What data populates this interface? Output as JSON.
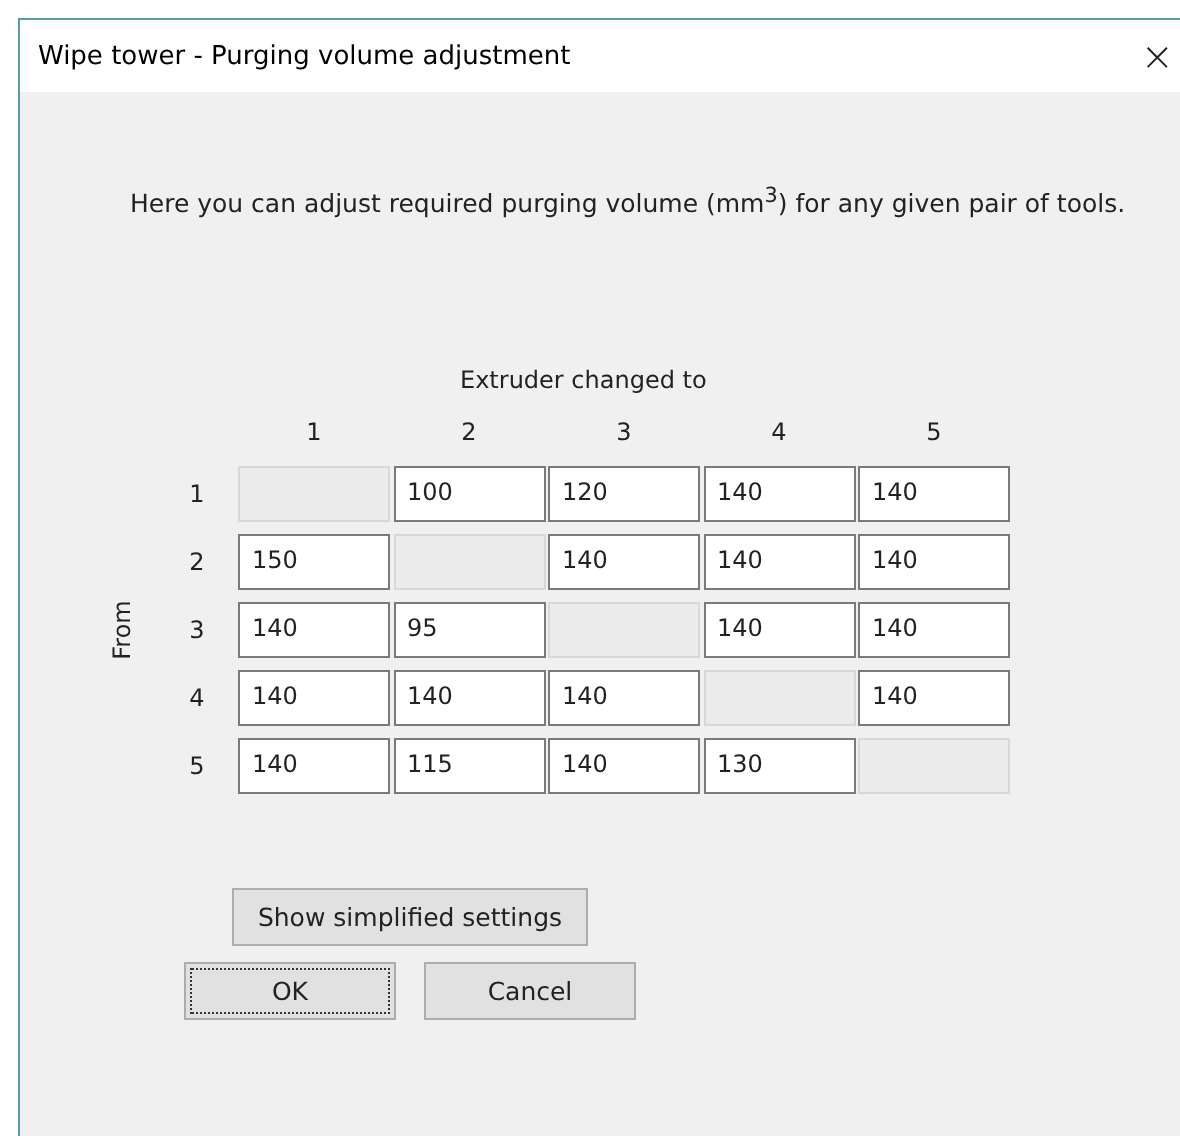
{
  "window": {
    "title": "Wipe tower - Purging volume adjustment",
    "close": "×"
  },
  "description": "Here you can adjust required purging volume (mm$^{3}$) for any given pair of tools.",
  "matrix": {
    "column_title": "Extruder changed to",
    "row_title": "From",
    "columns": [
      "1",
      "2",
      "3",
      "4",
      "5"
    ],
    "rows": [
      {
        "label": "1",
        "cells": [
          {
            "disabled": true
          },
          {
            "value": "100",
            "disabled": false
          },
          {
            "value": "120",
            "disabled": false
          },
          {
            "value": "140",
            "disabled": false
          },
          {
            "value": "140",
            "disabled": false
          }
        ]
      },
      {
        "label": "2",
        "cells": [
          {
            "value": "150",
            "disabled": false
          },
          {
            "disabled": true
          },
          {
            "value": "140",
            "disabled": false
          },
          {
            "value": "140",
            "disabled": false
          },
          {
            "value": "140",
            "disabled": false
          }
        ]
      },
      {
        "label": "3",
        "cells": [
          {
            "value": "140",
            "disabled": false
          },
          {
            "value": "95",
            "disabled": false
          },
          {
            "disabled": true
          },
          {
            "value": "140",
            "disabled": false
          },
          {
            "value": "140",
            "disabled": false
          }
        ]
      },
      {
        "label": "4",
        "cells": [
          {
            "value": "140",
            "disabled": false
          },
          {
            "value": "140",
            "disabled": false
          },
          {
            "value": "140",
            "disabled": false
          },
          {
            "disabled": true
          },
          {
            "value": "140",
            "disabled": false
          }
        ]
      },
      {
        "label": "5",
        "cells": [
          {
            "value": "140",
            "disabled": false
          },
          {
            "value": "115",
            "disabled": false
          },
          {
            "value": "140",
            "disabled": false
          },
          {
            "value": "130",
            "disabled": false
          },
          {
            "disabled": true
          }
        ]
      }
    ]
  },
  "toggle_button": "Show simplified settings",
  "buttons": [
    {
      "label": "OK",
      "focused": true
    },
    {
      "label": "Cancel",
      "focused": false
    }
  ]
}
